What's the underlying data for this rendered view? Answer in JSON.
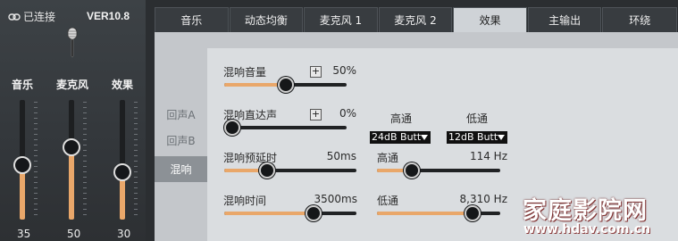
{
  "status": {
    "connection": "已连接",
    "version": "VER10.8"
  },
  "icons": {
    "link": "link-icon",
    "mic": "microphone-icon",
    "dropdown": "triangle-down-icon"
  },
  "colors": {
    "accent": "#e9a76a",
    "active_tab": "#cfd3d7",
    "panel": "#c4c7cb"
  },
  "channels": [
    {
      "label": "音乐",
      "value": "35",
      "level": 0.45
    },
    {
      "label": "麦克风",
      "value": "50",
      "level": 0.62
    },
    {
      "label": "效果",
      "value": "30",
      "level": 0.38
    }
  ],
  "tabs": [
    {
      "label": "音乐",
      "active": false
    },
    {
      "label": "动态均衡",
      "active": false
    },
    {
      "label": "麦克风 1",
      "active": false
    },
    {
      "label": "麦克风 2",
      "active": false
    },
    {
      "label": "效果",
      "active": true
    },
    {
      "label": "主输出",
      "active": false
    },
    {
      "label": "环绕",
      "active": false
    }
  ],
  "subtabs": [
    {
      "label": "回声A",
      "active": false
    },
    {
      "label": "回声B",
      "active": false
    },
    {
      "label": "混响",
      "active": true
    }
  ],
  "reverb": {
    "volume": {
      "label": "混响音量",
      "value": "50%",
      "level": 0.5
    },
    "direct": {
      "label": "混响直达声",
      "value": "0%",
      "level": 0.0
    },
    "predelay": {
      "label": "混响预延时",
      "value": "50ms",
      "level": 0.3
    },
    "time": {
      "label": "混响时间",
      "value": "3500ms",
      "level": 0.7
    }
  },
  "filters": {
    "hp_header": "高通",
    "lp_header": "低通",
    "hp_type": "24dB Butt",
    "lp_type": "12dB Butt",
    "hp": {
      "label": "高通",
      "value": "114 Hz",
      "level": 0.25
    },
    "lp": {
      "label": "低通",
      "value": "8,310 Hz",
      "level": 0.82
    }
  },
  "watermark": {
    "text": "家庭影院网",
    "url": "www.hdav.com.cn"
  }
}
